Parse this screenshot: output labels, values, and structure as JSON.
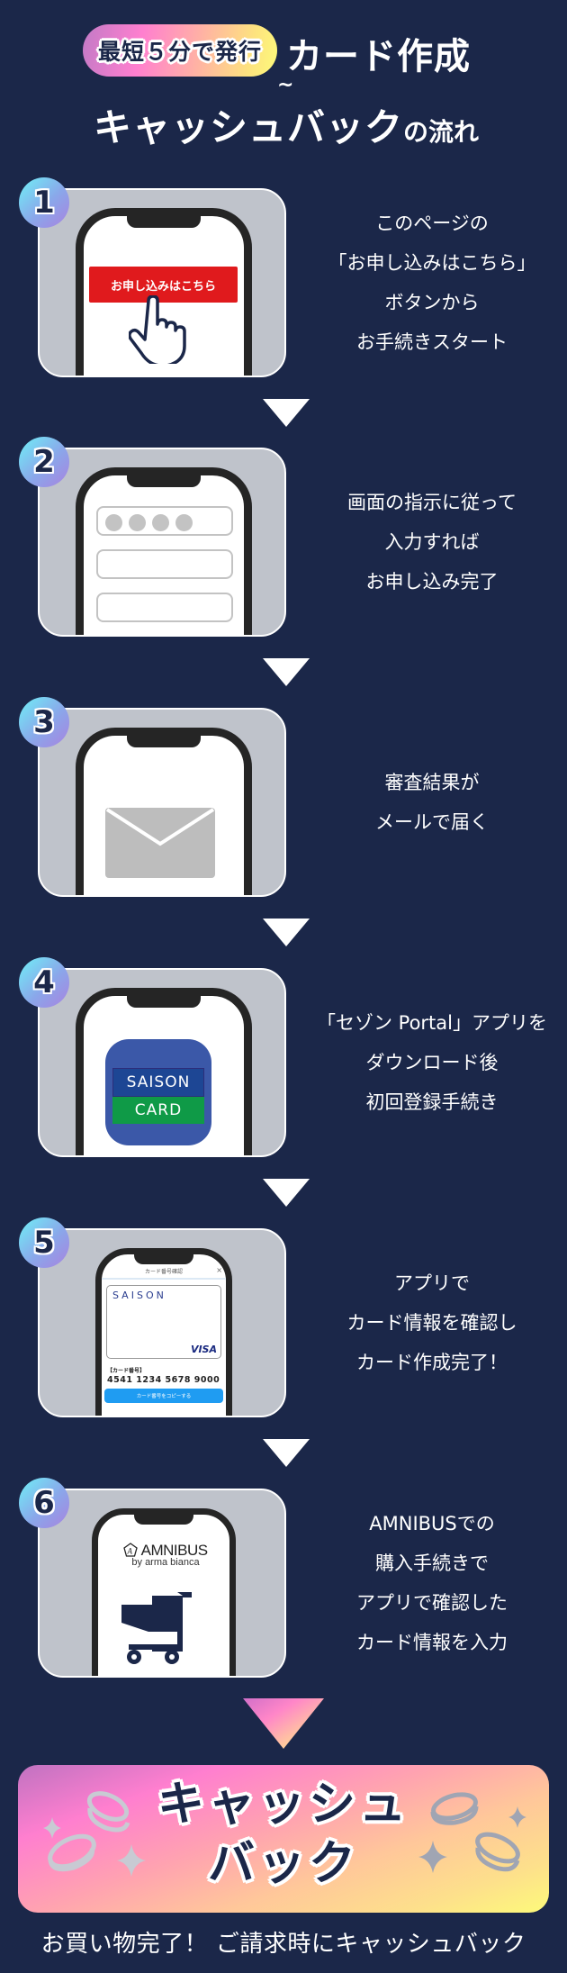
{
  "header": {
    "badge": "最短５分で発行",
    "title_line1": "カード作成",
    "tilde": "~",
    "title_line2_main": "キャッシュバック",
    "title_line2_suffix": "の流れ"
  },
  "colors": {
    "background": "#1b2749",
    "card_bg": "#bfc3cb",
    "apply_button": "#e01a1d",
    "saison_blue": "#3b58a8",
    "saison_green": "#0f9a47",
    "copy_button": "#1f9cf2"
  },
  "steps": [
    {
      "number": "1",
      "illustration": "phone-apply-button",
      "phone_button_label": "お申し込みはこちら",
      "icon": "pointing-hand-icon",
      "lines": [
        "このページの",
        "「お申し込みはこちら」",
        "ボタンから",
        "お手続きスタート"
      ]
    },
    {
      "number": "2",
      "illustration": "phone-form-fields",
      "icon": "form-fields-icon",
      "lines": [
        "画面の指示に従って",
        "入力すれば",
        "お申し込み完了"
      ]
    },
    {
      "number": "3",
      "illustration": "phone-mail",
      "icon": "envelope-icon",
      "lines": [
        "審査結果が",
        "メールで届く"
      ]
    },
    {
      "number": "4",
      "illustration": "phone-app-icon",
      "app_icon_top": "SAISON",
      "app_icon_bottom": "CARD",
      "lines": [
        "「セゾン Portal」アプリを",
        "ダウンロード後",
        "初回登録手続き"
      ]
    },
    {
      "number": "5",
      "illustration": "phone-card-number",
      "screen_title": "カード番号確認",
      "close_glyph": "×",
      "card_brand": "SAISON",
      "card_network": "VISA",
      "card_number_label": "【カード番号】",
      "card_number": "4541 1234  5678  9000",
      "copy_button_label": "カード番号をコピーする",
      "lines": [
        "アプリで",
        "カード情報を確認し",
        "カード作成完了！"
      ]
    },
    {
      "number": "6",
      "illustration": "phone-shopping-cart",
      "shop_brand": "AMNIBUS",
      "shop_sub": "by arma bianca",
      "icon": "shopping-cart-icon",
      "lines": [
        "AMNIBUSでの",
        "購入手続きで",
        "アプリで確認した",
        "カード情報を入力"
      ]
    }
  ],
  "cashback": {
    "line1": "キャッシュ",
    "line2": "バック",
    "footer": "お買い物完了！ ご請求時にキャッシュバック"
  }
}
